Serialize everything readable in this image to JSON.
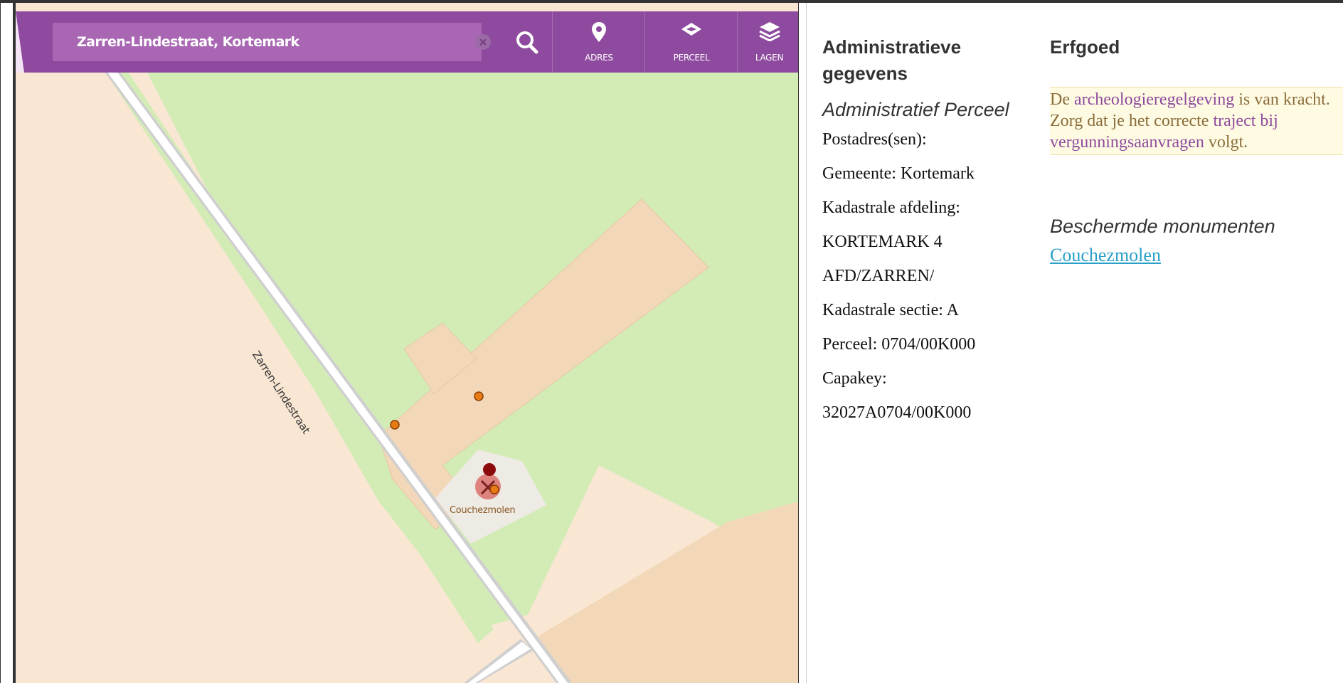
{
  "map": {
    "search": {
      "value": "Zarren-Lindestraat, Kortemark"
    },
    "toolbar": [
      {
        "label": "ADRES",
        "icon": "map-pin-icon"
      },
      {
        "label": "PERCEEL",
        "icon": "parcel-icon"
      },
      {
        "label": "LAGEN",
        "icon": "layers-icon"
      }
    ],
    "street_label": "Zarren-Lindestraat",
    "poi_label": "Couchezmolen",
    "colors": {
      "toolbar": "#8e4a9e",
      "land": "#f9e6d3",
      "parcel": "#f2d7b8",
      "grass": "#d3ecb6",
      "road": "#ffffff"
    }
  },
  "admin": {
    "heading": "Administratieve gegevens",
    "subheading": "Administratief Perceel",
    "lines": [
      "Postadres(sen):",
      "Gemeente: Kortemark",
      "Kadastrale afdeling:",
      "KORTEMARK 4",
      "AFD/ZARREN/",
      "Kadastrale sectie: A",
      "Perceel: 0704/00K000",
      "Capakey:",
      "32027A0704/00K000"
    ]
  },
  "heritage": {
    "heading": "Erfgoed",
    "notice": {
      "part1": "De ",
      "link1": "archeologieregelgeving",
      "part2": " is van kracht. Zorg dat je het correcte ",
      "link2": "traject bij vergunningsaanvragen",
      "part3": " volgt."
    },
    "subheading": "Beschermde monumenten",
    "monuments": [
      "Couchezmolen"
    ]
  }
}
